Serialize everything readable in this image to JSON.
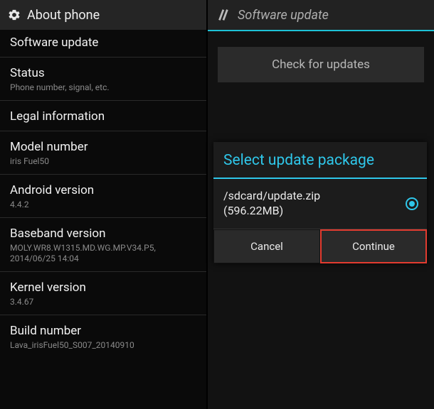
{
  "left": {
    "header": "About phone",
    "items": [
      {
        "title": "Software update",
        "sub": ""
      },
      {
        "title": "Status",
        "sub": "Phone number, signal, etc."
      },
      {
        "title": "Legal information",
        "sub": ""
      },
      {
        "title": "Model number",
        "sub": "iris Fuel50"
      },
      {
        "title": "Android version",
        "sub": "4.4.2"
      },
      {
        "title": "Baseband version",
        "sub": "MOLY.WR8.W1315.MD.WG.MP.V34.P5, 2014/06/25 14:04"
      },
      {
        "title": "Kernel version",
        "sub": "3.4.67"
      },
      {
        "title": "Build number",
        "sub": "Lava_irisFuel50_S007_20140910"
      }
    ]
  },
  "right": {
    "header": "Software update",
    "check_button": "Check for updates",
    "dialog": {
      "title": "Select update package",
      "option_path": "/sdcard/update.zip",
      "option_size": "(596.22MB)",
      "cancel": "Cancel",
      "continue": "Continue"
    }
  }
}
